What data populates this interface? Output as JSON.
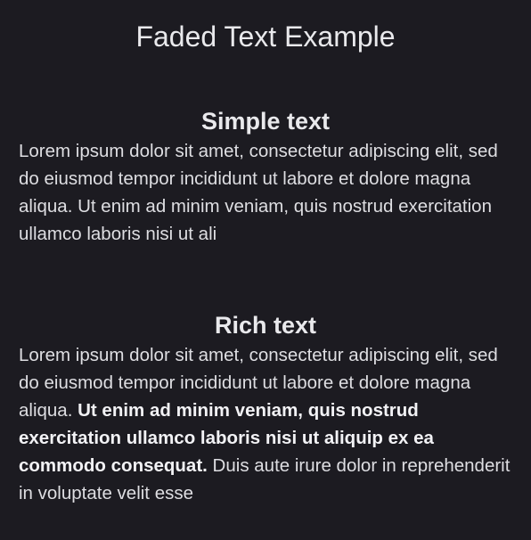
{
  "page": {
    "title": "Faded Text Example"
  },
  "simple": {
    "title": "Simple text",
    "body": "Lorem ipsum dolor sit amet, consectetur adipiscing elit, sed do eiusmod tempor incididunt ut labore et dolore magna aliqua. Ut enim ad minim veniam, quis nostrud exercitation ullamco laboris nisi ut ali"
  },
  "rich": {
    "title": "Rich text",
    "body_before": "Lorem ipsum dolor sit amet, consectetur adipiscing elit, sed do eiusmod tempor incididunt ut labore et dolore magna aliqua. ",
    "body_bold": "Ut enim ad minim veniam, quis nostrud exercitation ullamco laboris nisi ut aliquip ex ea commodo consequat.",
    "body_after": " Duis aute irure dolor in reprehenderit in voluptate velit esse"
  },
  "colors": {
    "background": "#1c1b21",
    "text": "#dedee2"
  }
}
